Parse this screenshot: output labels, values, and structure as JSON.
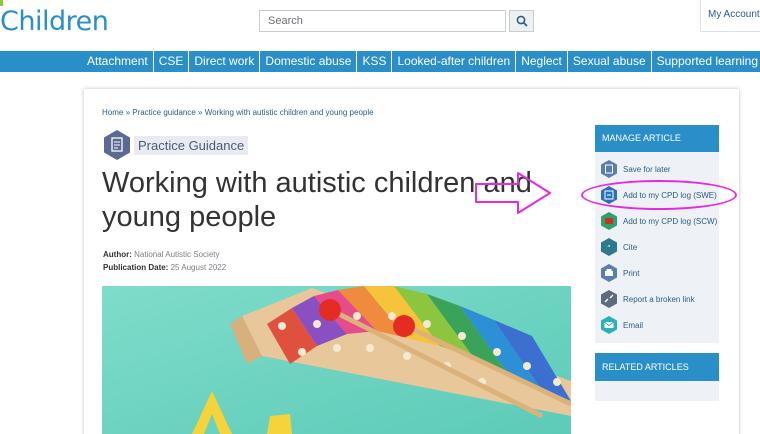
{
  "header": {
    "logo_text": "Children",
    "search_placeholder": "Search",
    "account_link": "My Account"
  },
  "nav": {
    "items": [
      "Attachment",
      "CSE",
      "Direct work",
      "Domestic abuse",
      "KSS",
      "Looked-after children",
      "Neglect",
      "Sexual abuse",
      "Supported learning"
    ]
  },
  "article": {
    "breadcrumb": "Home » Practice guidance » Working with autistic children and young people",
    "badge": "Practice Guidance",
    "title": "Working with autistic children and young people",
    "author_label": "Author:",
    "author": "National Autistic Society",
    "date_label": "Publication Date:",
    "date": "25 August 2022"
  },
  "sidebar": {
    "manage_title": "MANAGE ARTICLE",
    "items": [
      {
        "label": "Save for later",
        "icon": "save-icon"
      },
      {
        "label": "Add to my CPD log (SWE)",
        "icon": "cpd-swe-icon"
      },
      {
        "label": "Add to my CPD log (SCW)",
        "icon": "cpd-scw-icon"
      },
      {
        "label": "Cite",
        "icon": "cite-icon"
      },
      {
        "label": "Print",
        "icon": "print-icon"
      },
      {
        "label": "Report a broken link",
        "icon": "broken-link-icon"
      },
      {
        "label": "Email",
        "icon": "email-icon"
      }
    ],
    "related_title": "RELATED ARTICLES"
  },
  "colors": {
    "brand_blue": "#2a8fc8",
    "annotation_magenta": "#e32be3",
    "icon_hex_blue": "#5b7eb0",
    "icon_hex_green": "#2ea26a",
    "icon_hex_teal": "#2bb0b8"
  }
}
